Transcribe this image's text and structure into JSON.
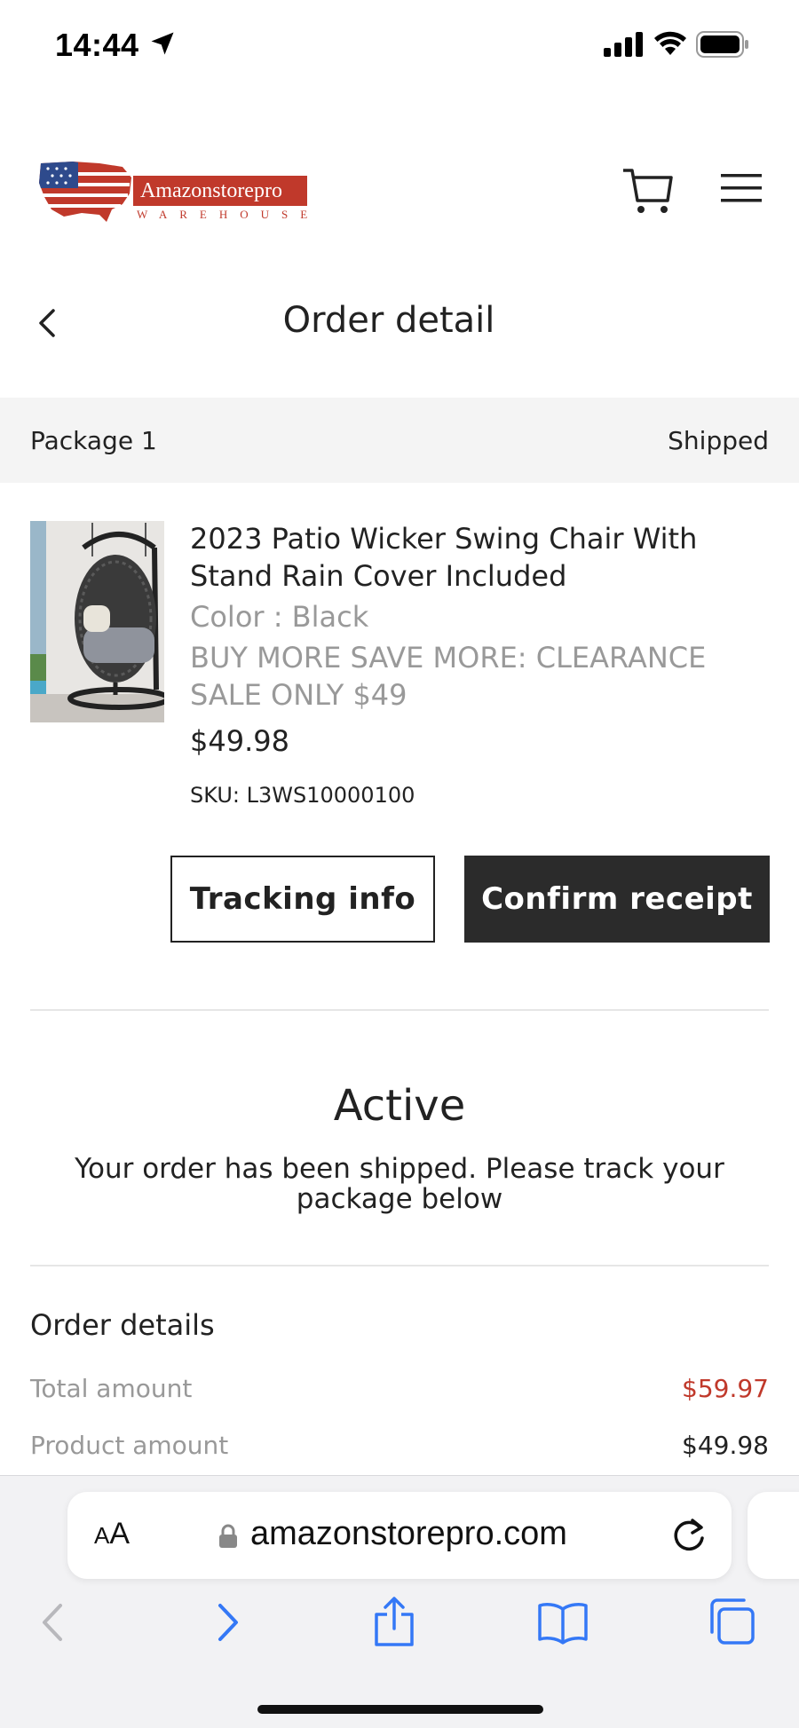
{
  "status_bar": {
    "time": "14:44"
  },
  "header": {
    "logo_title": "Amazonstorepro",
    "logo_subtitle": "WAREHOUSE"
  },
  "page": {
    "title": "Order detail"
  },
  "package": {
    "label": "Package 1",
    "status": "Shipped"
  },
  "product": {
    "name": "2023 Patio Wicker Swing Chair With Stand Rain Cover Included",
    "color": "Color : Black",
    "promo": "BUY MORE SAVE MORE: CLEARANCE SALE ONLY $49",
    "price": "$49.98",
    "sku": "SKU: L3WS10000100"
  },
  "actions": {
    "tracking_label": "Tracking info",
    "confirm_label": "Confirm receipt"
  },
  "order_status": {
    "title": "Active",
    "message": "Your order has been shipped. Please track your package below"
  },
  "order_details": {
    "title": "Order details",
    "rows": [
      {
        "label": "Total amount",
        "value": "$59.97"
      },
      {
        "label": "Product amount",
        "value": "$49.98"
      }
    ]
  },
  "browser": {
    "aa_label_small": "A",
    "aa_label_large": "A",
    "url": "amazonstorepro.com"
  },
  "colors": {
    "accent_red": "#c0392b",
    "ios_blue": "#3478f6",
    "dark_button": "#2b2b2b"
  }
}
